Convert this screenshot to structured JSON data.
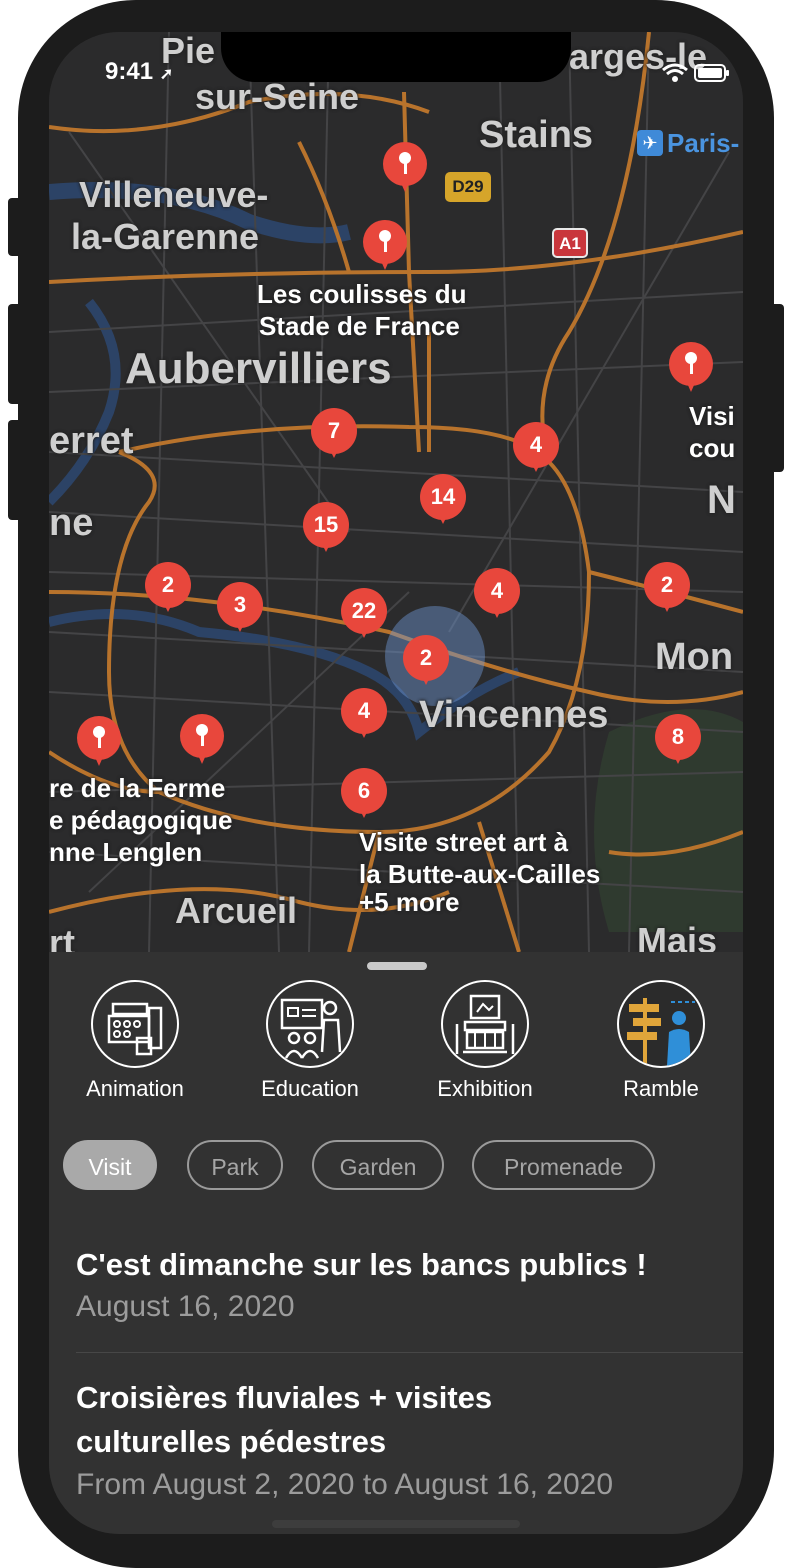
{
  "status_bar": {
    "time": "9:41"
  },
  "map": {
    "places": [
      {
        "name": "Pie"
      },
      {
        "name": "sur-Seine"
      },
      {
        "name": "Stains"
      },
      {
        "name": "arges-le"
      },
      {
        "name": "Villeneuve-"
      },
      {
        "name": "la-Garenne"
      },
      {
        "name": "Aubervilliers"
      },
      {
        "name": "erret"
      },
      {
        "name": "ne"
      },
      {
        "name": "Mon"
      },
      {
        "name": "Vincennes"
      },
      {
        "name": "Arcueil"
      },
      {
        "name": "Mais"
      },
      {
        "name": "N"
      },
      {
        "name": "rt"
      }
    ],
    "road_labels": {
      "d29": "D29",
      "a1": "A1"
    },
    "airport_label": "Paris-",
    "poi_labels": {
      "stade_line1": "Les coulisses du",
      "stade_line2": "Stade de France",
      "right_line1": "Visi",
      "right_line2": "cou",
      "ferme_line1": "re de la Ferme",
      "ferme_line2": "e pédagogique",
      "ferme_line3": "nne Lenglen",
      "street_line1": "Visite street art à",
      "street_line2": "la Butte-aux-Cailles",
      "street_more": "+5 more"
    },
    "clusters": [
      {
        "count": "7"
      },
      {
        "count": "4"
      },
      {
        "count": "14"
      },
      {
        "count": "15"
      },
      {
        "count": "2"
      },
      {
        "count": "3"
      },
      {
        "count": "22"
      },
      {
        "count": "4"
      },
      {
        "count": "2"
      },
      {
        "count": "2"
      },
      {
        "count": "4"
      },
      {
        "count": "8"
      },
      {
        "count": "6"
      }
    ],
    "pin_color": "#e8473c"
  },
  "categories": [
    {
      "label": "Animation",
      "icon": "animation-icon"
    },
    {
      "label": "Education",
      "icon": "education-icon"
    },
    {
      "label": "Exhibition",
      "icon": "exhibition-icon"
    },
    {
      "label": "Ramble",
      "icon": "ramble-icon"
    }
  ],
  "filters": [
    {
      "label": "Visit",
      "active": true
    },
    {
      "label": "Park",
      "active": false
    },
    {
      "label": "Garden",
      "active": false
    },
    {
      "label": "Promenade",
      "active": false
    }
  ],
  "events": [
    {
      "title": "C'est dimanche sur les bancs publics !",
      "date": "August 16, 2020"
    },
    {
      "title": "Croisières fluviales + visites culturelles pédestres",
      "date": "From August 2, 2020 to August 16, 2020"
    }
  ]
}
